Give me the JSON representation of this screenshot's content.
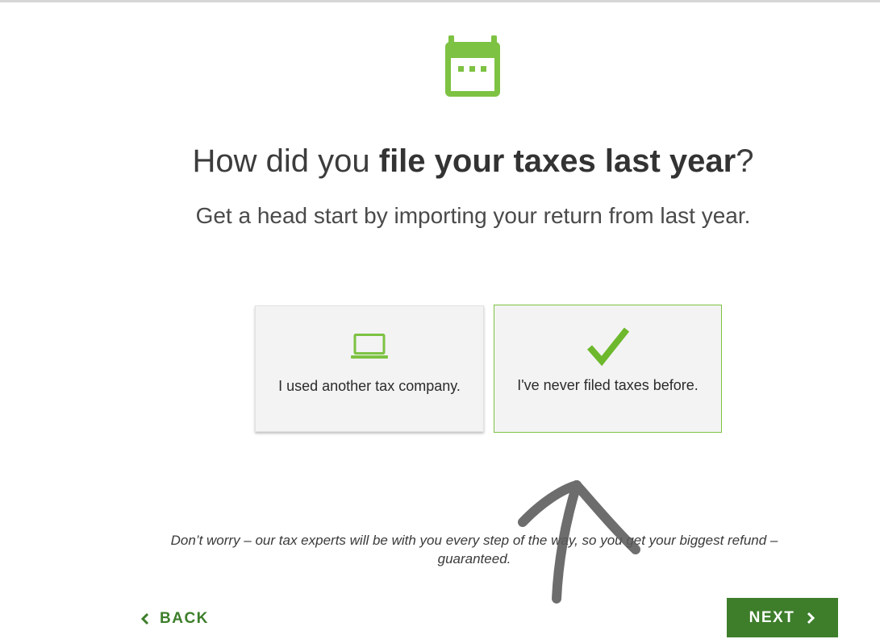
{
  "header": {
    "icon": "calendar-icon",
    "question_prefix": "How did you ",
    "question_bold": "file your taxes last year",
    "question_suffix": "?",
    "subtitle": "Get a head start by importing your return from last year."
  },
  "options": [
    {
      "icon": "laptop-icon",
      "label": "I used another tax company.",
      "selected": false
    },
    {
      "icon": "checkmark-icon",
      "label": "I've never filed taxes before.",
      "selected": true
    }
  ],
  "footer": {
    "reassurance": "Don’t worry – our tax experts will be with you every step of the way, so you get your biggest refund – guaranteed.",
    "back_label": "BACK",
    "next_label": "NEXT"
  },
  "colors": {
    "accent_green": "#7dc242",
    "button_green": "#3e7e2b",
    "card_bg": "#f3f3f4"
  }
}
